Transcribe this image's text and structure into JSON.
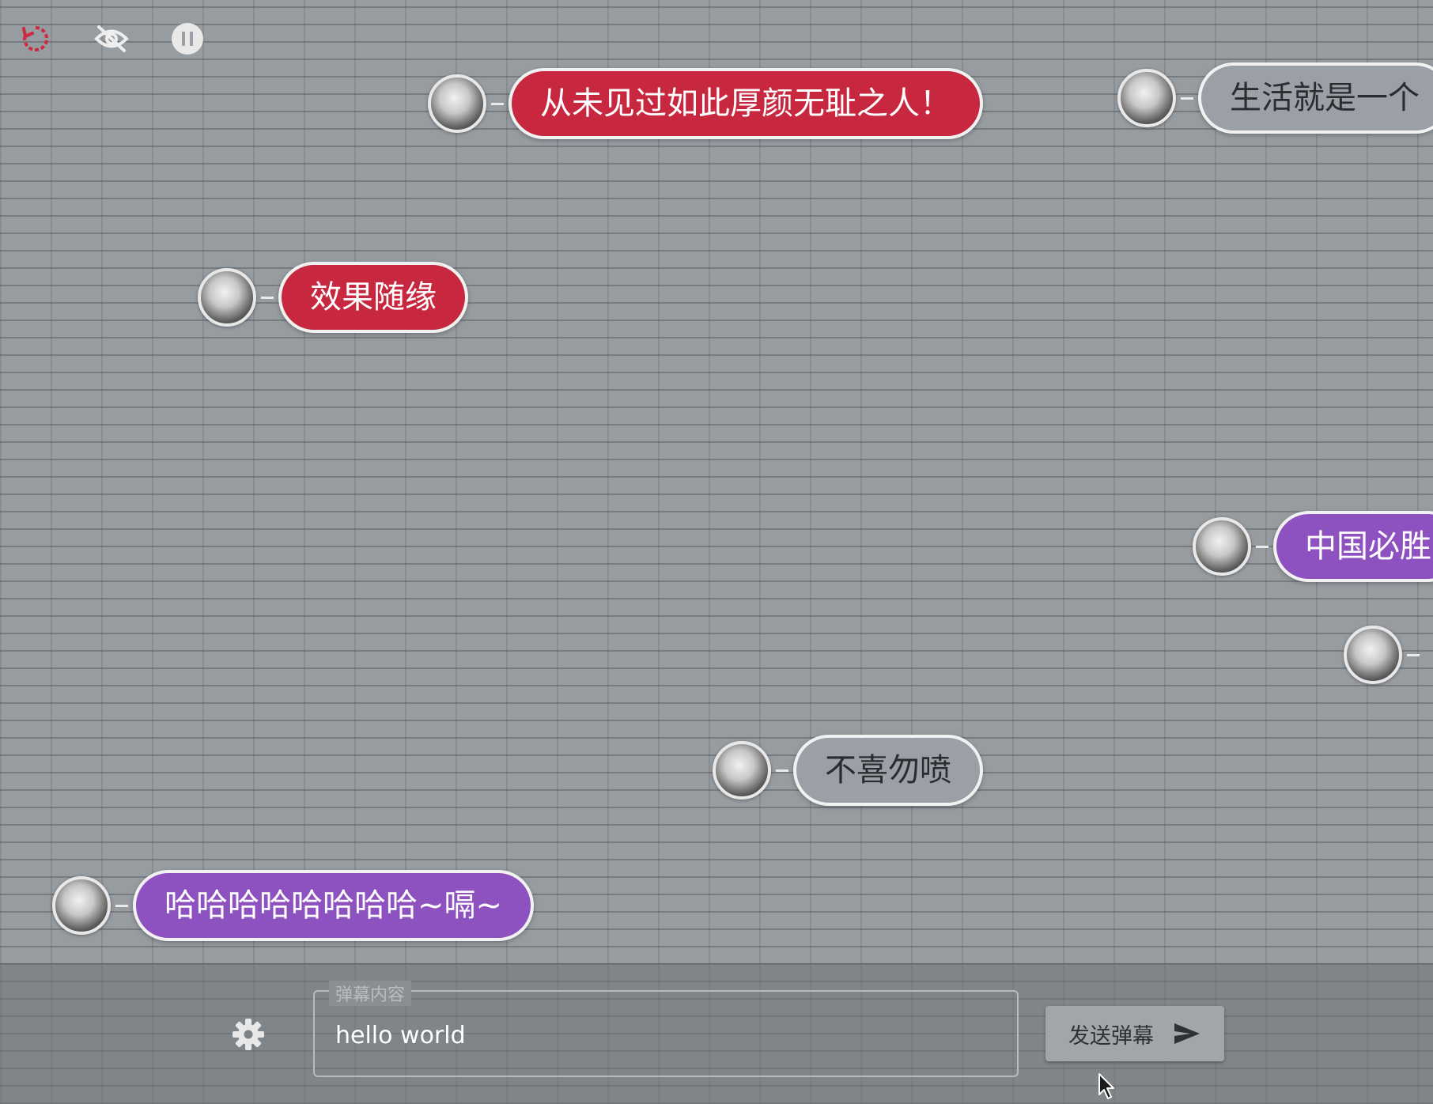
{
  "controls": {
    "replay_icon": "replay-icon",
    "hide_icon": "eye-off-icon",
    "pause_icon": "pause-icon"
  },
  "danmaku": [
    {
      "text": "从未见过如此厚颜无耻之人！",
      "color": "red"
    },
    {
      "text": "生活就是一个",
      "color": "gray"
    },
    {
      "text": "效果随缘",
      "color": "red"
    },
    {
      "text": "中国必胜",
      "color": "purple"
    },
    {
      "text": "不喜勿喷",
      "color": "gray"
    },
    {
      "text": "哈哈哈哈哈哈哈哈~嗝~",
      "color": "purple"
    }
  ],
  "colors": {
    "red": "#c8283f",
    "purple": "#8e52c0",
    "gray": "#9aa0a6"
  },
  "input": {
    "legend": "弹幕内容",
    "value": "hello world"
  },
  "send_button": {
    "label": "发送弹幕"
  }
}
